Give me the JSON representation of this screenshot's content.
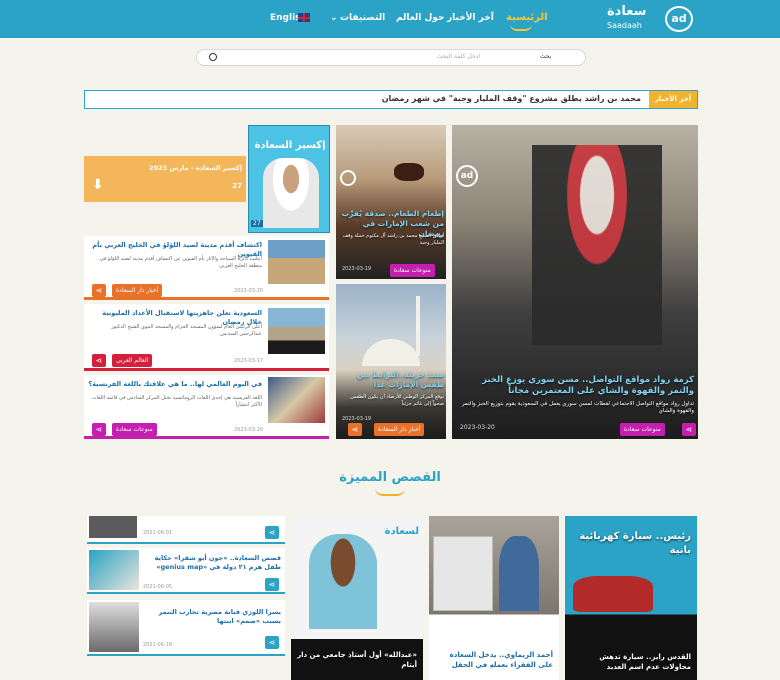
{
  "header": {
    "logo_text": "سعادة",
    "logo_latin": "Saadaah",
    "home": "الرئيسية",
    "latest": "آخر الأخبار",
    "world": "حول العالم",
    "categories": "التصنيفات",
    "english": "English"
  },
  "search": {
    "button": "بحث",
    "placeholder": "ادخل كلمة البحث"
  },
  "ticker": {
    "label": "آخر الأخبار",
    "text": "محمد بن راشد يطلق مشروع \"وقف المليار وجبة\" في شهر رمضان"
  },
  "main_story": {
    "title": "كرمة رواد مواقع التواصل.. مسن سوري يوزع الخبز والتمر والقهوة والشاي على المعتمرين مجاناً",
    "summary": "تداول رواد مواقع التواصل الاجتماعي لقطات لمسن سوري يعمل في السعودية يقوم بتوزيع الخبز والتمر والقهوة والشاي",
    "date": "2023-03-20",
    "category": "منوعات سعادة"
  },
  "story2": {
    "title": "إطعام الطعام.. صدقة يُقرِّب من شعب الإمارات في رمضان",
    "summary": "أطلق الشيخ محمد بن راشد آل مكتوم حملة وقف المليار وجبة",
    "date": "2023-03-19",
    "category": "منوعات سعادة"
  },
  "story3": {
    "title": "صمد جزيئة..الترابط بين طقس الإمارات غدا",
    "summary": "توقع المركز الوطني للأرصاد أن يكون الطقس صحواً إلى غائم جزئياً",
    "date": "2023-03-19",
    "category": "أخبار دار السعادة"
  },
  "magazine": {
    "cover_title": "إكسير السعادة",
    "cover_num": "27",
    "title": "إكسير السعادة - مارس 2023",
    "num": "27"
  },
  "list": [
    {
      "title": "اكتشاف أقدم مدينة لصيد اللؤلؤ في الخليج العربي بأم القيوين",
      "summary": "أعلنت دائرة السياحة والآثار بأم القيوين عن اكتشاف أقدم مدينة لصيد اللؤلؤ في منطقة الخليج العربي",
      "date": "2023-03-20",
      "category": "أخبار دار السعادة"
    },
    {
      "title": "السعودية تعلن جاهزيتها لاستقبال الأعداد المليونية خلال رمضان",
      "summary": "أعلن الرئيس العام لشؤون المسجد الحرام والمسجد النبوي الشيخ الدكتور عبدالرحمن السديس",
      "date": "2023-03-17",
      "category": "العالم العربي"
    },
    {
      "title": "في اليوم العالمي لها.. ما هي علاقتك باللغة الفرنسية؟",
      "summary": "اللغة الفرنسية هي إحدى اللغات الرومانسية تحتل المركز السادس في قائمة اللغات الأكثر انتشاراً",
      "date": "2023-03-20",
      "category": "منوعات سعادة"
    }
  ],
  "featured": {
    "title": "القصص المميزة"
  },
  "stories": [
    {
      "title": "القدس رايز.. سيارة تدهش محاولات عدم اسم العديد",
      "top": "رئيس.. سيارة كهربائية بانية"
    },
    {
      "title": "أحمد الريماوي.. يدخل السعادة على الفقراء بعملهِ في الحقل"
    },
    {
      "title": "«عبدالله» أول أستاذ جامعي من دار أيتام",
      "top": "لسعادة"
    }
  ],
  "mini": [
    {
      "date": "2021-06-01",
      "title": ""
    },
    {
      "title": "قصص السعادة.. «جون أبو شقرا» حكاية طفل هزم ٢١ دولة في «genius map»",
      "date": "2021-06-05"
    },
    {
      "title": "يسرا اللوزي فنانة مصرية تحارب التنمر بسبب «صمم» ابنتها",
      "date": "2021-06-16"
    }
  ]
}
